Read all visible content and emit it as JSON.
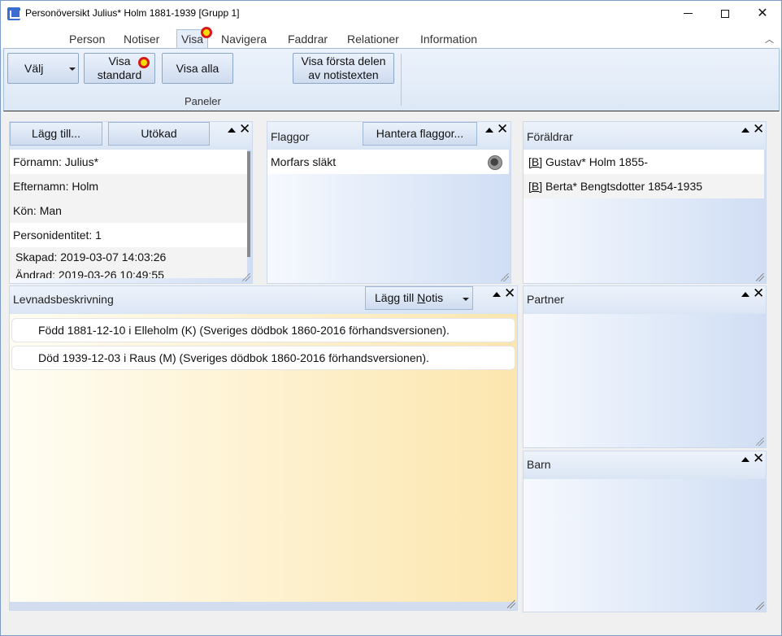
{
  "window": {
    "title": "Personöversikt Julius* Holm 1881-1939 [Grupp 1]"
  },
  "tabs": [
    {
      "label": "Person"
    },
    {
      "label": "Notiser"
    },
    {
      "label": "Visa"
    },
    {
      "label": "Navigera"
    },
    {
      "label": "Faddrar"
    },
    {
      "label": "Relationer"
    },
    {
      "label": "Information"
    }
  ],
  "ribbon": {
    "valj_label": "Välj",
    "visa_standard_line1": "Visa",
    "visa_standard_line2": "standard",
    "visa_alla_label": "Visa alla",
    "visa_forsta_line1": "Visa första delen",
    "visa_forsta_line2": "av notistexten",
    "group_label": "Paneler"
  },
  "person_panel": {
    "add_button": "Lägg till...",
    "extended_button": "Utökad",
    "rows": [
      "Förnamn: Julius*",
      "Efternamn: Holm",
      "Kön: Man",
      "Personidentitet: 1"
    ],
    "created": "Skapad:  2019-03-07  14:03:26",
    "changed": "Ändrad:  2019-03-26  10:49:55"
  },
  "flags_panel": {
    "title": "Flaggor",
    "manage_button": "Hantera flaggor...",
    "items": [
      "Morfars släkt"
    ]
  },
  "parents_panel": {
    "title": "Föräldrar",
    "items": [
      {
        "tag": "[B]",
        "text": "Gustav*  Holm  1855-"
      },
      {
        "tag": "[B]",
        "text": "Berta*  Bengtsdotter  1854-1935"
      }
    ]
  },
  "life_panel": {
    "title": "Levnadsbeskrivning",
    "add_notice_prefix": "Lägg till ",
    "add_notice_underlined": "N",
    "add_notice_suffix": "otis",
    "notices": [
      "Född 1881-12-10 i Elleholm (K) (Sveriges dödbok 1860-2016 förhandsversionen).",
      "Död 1939-12-03 i Raus (M) (Sveriges dödbok 1860-2016 förhandsversionen)."
    ]
  },
  "partner_panel": {
    "title": "Partner"
  },
  "children_panel": {
    "title": "Barn"
  },
  "colors": {
    "marker_fill": "#f5dd00",
    "marker_ring": "#d81818",
    "life_gradient_end": "#fce6ae"
  }
}
